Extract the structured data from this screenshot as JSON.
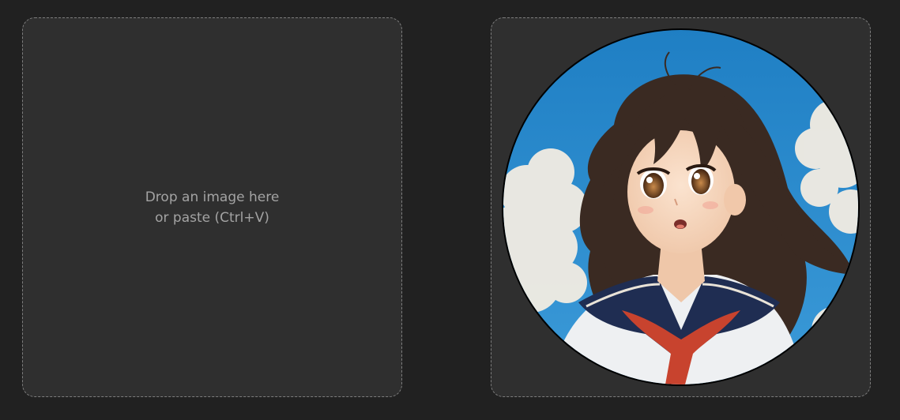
{
  "drop_zone": {
    "line1": "Drop an image here",
    "line2": "or paste (Ctrl+V)"
  },
  "preview": {
    "image_subject": "anime girl in sailor uniform against blue sky with clouds",
    "crop_shape": "circle"
  },
  "colors": {
    "background": "#212121",
    "panel": "#2f2f2f",
    "dashed_border": "#7d7d7d",
    "text": "#a3a3a3",
    "sky": "#2f8fd0"
  }
}
